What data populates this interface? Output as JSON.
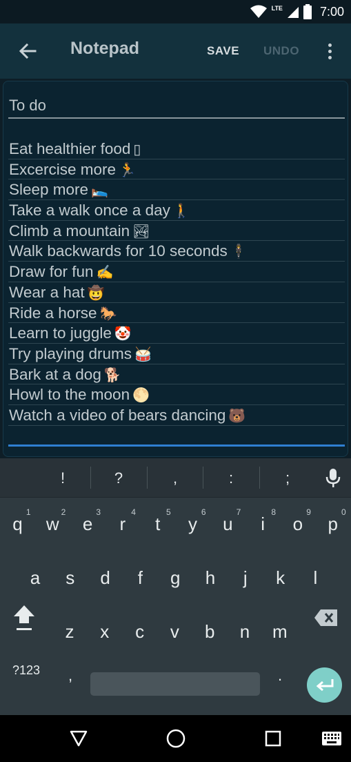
{
  "status_bar": {
    "time": "7:00",
    "network": "LTE",
    "icons": [
      "wifi-icon",
      "signal-icon",
      "battery-icon"
    ]
  },
  "app_bar": {
    "title": "Notepad",
    "save_label": "SAVE",
    "undo_label": "UNDO",
    "icons": [
      "back-arrow-icon",
      "more-vert-icon"
    ]
  },
  "note": {
    "title": "To do",
    "lines": [
      {
        "text": "Eat healthier food",
        "emoji": "▯"
      },
      {
        "text": "Excercise more",
        "emoji": "🏃"
      },
      {
        "text": "Sleep more",
        "emoji": "🛌"
      },
      {
        "text": "Take a walk once a day",
        "emoji": "🚶"
      },
      {
        "text": "Climb a mountain",
        "emoji": "🏞"
      },
      {
        "text": "Walk backwards for 10 seconds",
        "emoji": "🕴"
      },
      {
        "text": "Draw for fun",
        "emoji": "✍️"
      },
      {
        "text": "Wear a hat",
        "emoji": "🤠"
      },
      {
        "text": "Ride a horse",
        "emoji": "🐎"
      },
      {
        "text": "Learn to juggle",
        "emoji": "🤡"
      },
      {
        "text": "Try playing drums",
        "emoji": "🥁"
      },
      {
        "text": "Bark at a dog",
        "emoji": "🐕"
      },
      {
        "text": "Howl to the moon",
        "emoji": "🌕"
      },
      {
        "text": "Watch a video of bears dancing",
        "emoji": "🐻"
      }
    ]
  },
  "keyboard": {
    "suggestions": [
      "!",
      "?",
      ",",
      ":",
      ";"
    ],
    "row1": [
      {
        "k": "q",
        "h": "1"
      },
      {
        "k": "w",
        "h": "2"
      },
      {
        "k": "e",
        "h": "3"
      },
      {
        "k": "r",
        "h": "4"
      },
      {
        "k": "t",
        "h": "5"
      },
      {
        "k": "y",
        "h": "6"
      },
      {
        "k": "u",
        "h": "7"
      },
      {
        "k": "i",
        "h": "8"
      },
      {
        "k": "o",
        "h": "9"
      },
      {
        "k": "p",
        "h": "0"
      }
    ],
    "row2": [
      "a",
      "s",
      "d",
      "f",
      "g",
      "h",
      "j",
      "k",
      "l"
    ],
    "row3": [
      "z",
      "x",
      "c",
      "v",
      "b",
      "n",
      "m"
    ],
    "symbols_label": "?123",
    "comma": ",",
    "period": ".",
    "icons": [
      "mic-icon",
      "shift-icon",
      "backspace-icon",
      "enter-icon"
    ]
  },
  "nav_bar": {
    "icons": [
      "back-triangle-icon",
      "home-circle-icon",
      "recents-square-icon",
      "keyboard-switch-icon"
    ]
  },
  "colors": {
    "app_bar": "#13313d",
    "background": "#0e1e27",
    "focus_line": "#2f7fd1",
    "enter_key": "#7fcfc8"
  }
}
